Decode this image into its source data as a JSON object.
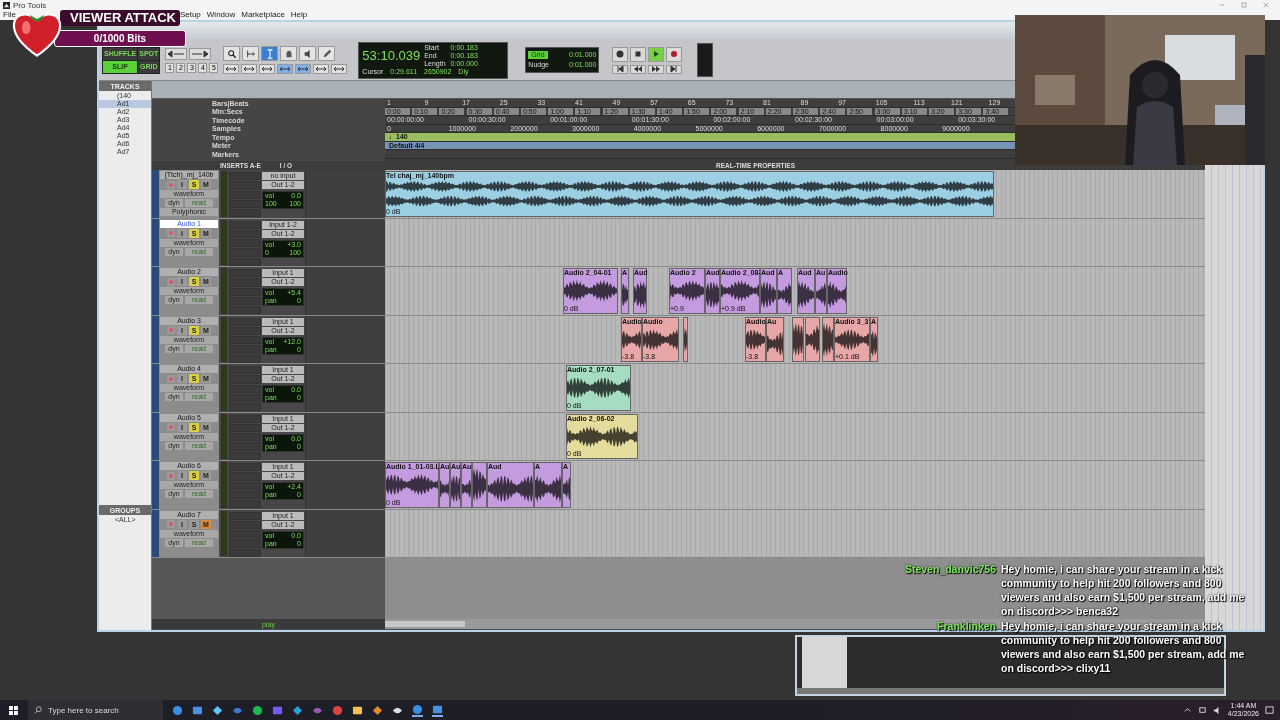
{
  "window": {
    "title": "Pro Tools"
  },
  "menu": [
    "File",
    "Setup",
    "Window",
    "Marketplace",
    "Help"
  ],
  "stream_alert": {
    "title": "VIEWER ATTACK",
    "progress_text": "0/1000 Bits",
    "level": 0
  },
  "toolbar": {
    "edit_modes": [
      {
        "label": "SHUFFLE",
        "selected": false
      },
      {
        "label": "SPOT",
        "selected": false
      },
      {
        "label": "SLIP",
        "selected": true
      },
      {
        "label": "GRID",
        "selected": false
      }
    ],
    "zoom_presets": [
      "1",
      "2",
      "3",
      "4",
      "5"
    ],
    "tools": [
      {
        "kind": "zoom",
        "selected": false
      },
      {
        "kind": "trim",
        "selected": false
      },
      {
        "kind": "selector",
        "selected": true
      },
      {
        "kind": "grabber",
        "selected": false
      },
      {
        "kind": "scrub",
        "selected": false
      },
      {
        "kind": "pencil",
        "selected": false
      }
    ],
    "main_counter": "53:10.039",
    "selection": [
      {
        "label": "Start",
        "value": "0:00.183"
      },
      {
        "label": "End",
        "value": "0:00.183"
      },
      {
        "label": "Length",
        "value": "0:00.000"
      }
    ],
    "cursor": {
      "label": "Cursor",
      "value": "0:29.611"
    },
    "sample_readout": "2650902",
    "delay_label": "Dly",
    "grid": {
      "label": "Grid",
      "value": "0:01.000"
    },
    "nudge": {
      "label": "Nudge",
      "value": "0:01.000"
    },
    "playing": true
  },
  "tracks_list": {
    "title": "TRACKS",
    "items": [
      {
        "name": "(140",
        "selected": false
      },
      {
        "name": "Ad1",
        "selected": true
      },
      {
        "name": "Ad2",
        "selected": false
      },
      {
        "name": "Ad3",
        "selected": false
      },
      {
        "name": "Ad4",
        "selected": false
      },
      {
        "name": "Ad5",
        "selected": false
      },
      {
        "name": "Ad6",
        "selected": false
      },
      {
        "name": "Ad7",
        "selected": false
      }
    ]
  },
  "groups_list": {
    "title": "GROUPS",
    "items": [
      "<ALL>"
    ]
  },
  "rulers": {
    "labels": [
      "Bars|Beats",
      "Min:Secs",
      "Timecode",
      "Samples",
      "Tempo",
      "Meter",
      "Markers"
    ],
    "bars": [
      "1",
      "9",
      "17",
      "25",
      "33",
      "41",
      "49",
      "57",
      "65",
      "73",
      "81",
      "89",
      "97",
      "105",
      "113",
      "121",
      "129"
    ],
    "min_secs": [
      "0:00",
      "0:10",
      "0:20",
      "0:30",
      "0:40",
      "0:50",
      "1:00",
      "1:10",
      "1:20",
      "1:30",
      "1:40",
      "1:50",
      "2:00",
      "2:10",
      "2:20",
      "2:30",
      "2:40",
      "2:50",
      "3:00",
      "3:10",
      "3:20",
      "3:30",
      "3:40"
    ],
    "timecode": [
      "00:00:00:00",
      "00:00:30:00",
      "00:01:00:00",
      "00:01:30:00",
      "00:02:00:00",
      "00:02:30:00",
      "00:03:00:00",
      "00:03:30:00"
    ],
    "samples": [
      "0",
      "1000000",
      "2000000",
      "3000000",
      "4000000",
      "5000000",
      "6000000",
      "7000000",
      "8000000",
      "9000000"
    ],
    "tempo": "♩140",
    "meter": "Default 4/4"
  },
  "columns": [
    "INSERTS A-E",
    "I / O",
    "REAL-TIME PROPERTIES"
  ],
  "tracks": [
    {
      "name": "(Ttch)_mj_140b",
      "selected": false,
      "monitor_label": "I",
      "solo_label": "S",
      "mute_label": "M",
      "solo": true,
      "mute": false,
      "view": "waveform",
      "dyn": "dyn",
      "automation": "read",
      "extra": "Polyphonic",
      "input": "no input",
      "output": "Out 1-2",
      "mix": {
        "vol_label": "vol",
        "vol": "0.0",
        "pan": [
          "100",
          "100"
        ]
      },
      "color": "#9ccfe3",
      "clips": [
        {
          "name": "Tel chaj_mj_140bpm",
          "gain": "0 dB",
          "selected": false
        }
      ]
    },
    {
      "name": "Audio 1",
      "selected": true,
      "monitor_label": "I",
      "solo_label": "S",
      "mute_label": "M",
      "solo": true,
      "mute": false,
      "view": "waveform",
      "dyn": "dyn",
      "automation": "read",
      "input": "Input 1-2",
      "output": "Out 1-2",
      "mix": {
        "vol_label": "vol",
        "vol": "+3.0",
        "pan": [
          "0",
          "100"
        ]
      }
    },
    {
      "name": "Audio 2",
      "selected": false,
      "monitor_label": "I",
      "solo_label": "S",
      "mute_label": "M",
      "solo": true,
      "mute": false,
      "view": "waveform",
      "dyn": "dyn",
      "automation": "read",
      "input": "Input 1",
      "output": "Out 1-2",
      "mix": {
        "vol_label": "vol",
        "vol": "+5.4",
        "pan_label": "pan",
        "pan": [
          "0"
        ]
      },
      "color": "#c59be0",
      "clips": [
        {
          "name": "Audio 2_04-01",
          "gain": "0 dB",
          "selected": false
        },
        {
          "name": "A",
          "selected": false
        },
        {
          "name": "Aud",
          "selected": false
        },
        {
          "name": "Audio 2",
          "gain": "+0.9",
          "selected": false
        },
        {
          "name": "Aud",
          "selected": false
        },
        {
          "name": "Audio 2_08-",
          "gain": "+0.9 dB",
          "selected": false
        },
        {
          "name": "Aud",
          "selected": false
        },
        {
          "name": "A",
          "selected": false
        },
        {
          "name": "Aud",
          "selected": false
        },
        {
          "name": "Au",
          "selected": false
        },
        {
          "name": "Audio",
          "selected": false
        }
      ]
    },
    {
      "name": "Audio 3",
      "selected": false,
      "monitor_label": "I",
      "solo_label": "S",
      "mute_label": "M",
      "solo": true,
      "mute": false,
      "view": "waveform",
      "dyn": "dyn",
      "automation": "read",
      "input": "Input 1",
      "output": "Out 1-2",
      "mix": {
        "vol_label": "vol",
        "vol": "+12.0",
        "pan_label": "pan",
        "pan": [
          "0"
        ]
      },
      "color": "#e7a7a7",
      "clips": [
        {
          "name": "Audio",
          "gain": "-3.8",
          "selected": false
        },
        {
          "name": "Audio",
          "gain": "-3.8",
          "selected": false
        },
        {
          "selected": false
        },
        {
          "name": "Audio",
          "gain": "-3.8",
          "selected": false
        },
        {
          "name": "Au",
          "selected": false
        },
        {
          "selected": false
        },
        {
          "selected": false
        },
        {
          "selected": false
        },
        {
          "name": "Audio 3_3",
          "gain": "+0.1 dB",
          "selected": false
        },
        {
          "name": "A",
          "selected": false
        }
      ]
    },
    {
      "name": "Audio 4",
      "selected": false,
      "monitor_label": "I",
      "solo_label": "S",
      "mute_label": "M",
      "solo": true,
      "mute": false,
      "view": "waveform",
      "dyn": "dyn",
      "automation": "read",
      "input": "Input 1",
      "output": "Out 1-2",
      "mix": {
        "vol_label": "vol",
        "vol": "0.0",
        "pan_label": "pan",
        "pan": [
          "0"
        ]
      },
      "color": "#a6dcc0",
      "clips": [
        {
          "name": "Audio 2_07-01",
          "gain": "0 dB",
          "selected": false
        }
      ]
    },
    {
      "name": "Audio 5",
      "selected": false,
      "monitor_label": "I",
      "solo_label": "S",
      "mute_label": "M",
      "solo": true,
      "mute": false,
      "view": "waveform",
      "dyn": "dyn",
      "automation": "read",
      "input": "Input 1",
      "output": "Out 1-2",
      "mix": {
        "vol_label": "vol",
        "vol": "0.0",
        "pan_label": "pan",
        "pan": [
          "0"
        ]
      },
      "color": "#e3dc9c",
      "clips": [
        {
          "name": "Audio 2_06-02",
          "gain": "0 dB",
          "selected": false
        }
      ]
    },
    {
      "name": "Audio 6",
      "selected": false,
      "monitor_label": "I",
      "solo_label": "S",
      "mute_label": "M",
      "solo": true,
      "mute": false,
      "view": "waveform",
      "dyn": "dyn",
      "automation": "read",
      "input": "Input 1",
      "output": "Out 1-2",
      "mix": {
        "vol_label": "vol",
        "vol": "+2.4",
        "pan_label": "pan",
        "pan": [
          "0"
        ]
      },
      "color": "#c59be0",
      "clips": [
        {
          "name": "Audio 1_01-03.L",
          "gain": "0 dB",
          "selected": false
        },
        {
          "name": "Au",
          "selected": false
        },
        {
          "name": "Au",
          "selected": false
        },
        {
          "name": "Au",
          "selected": false
        },
        {
          "selected": false
        },
        {
          "name": "Aud",
          "selected": false
        },
        {
          "name": "A",
          "selected": false
        },
        {
          "name": "A",
          "selected": false
        }
      ]
    },
    {
      "name": "Audio 7",
      "selected": false,
      "monitor_label": "I",
      "solo_label": "S",
      "mute_label": "M",
      "solo": false,
      "mute": true,
      "view": "waveform",
      "dyn": "dyn",
      "automation": "read",
      "input": "Input 1",
      "output": "Out 1-2",
      "mix": {
        "vol_label": "vol",
        "vol": "0.0",
        "pan_label": "pan",
        "pan": [
          "0"
        ]
      }
    }
  ],
  "status_text": "play",
  "chat": [
    {
      "user": "Steven_danvic756",
      "message": "Hey homie, i can share your stream in a kick community to help hit 200 followers and 800 viewers and also earn $1,500 per stream, add me on discord>>> benca32"
    },
    {
      "user": "Franklinken",
      "message": "Hey homie, i can share your stream in a kick community to help hit 200 followers and 800 viewers and also earn $1,500 per stream, add me on discord>>> clixy11"
    }
  ],
  "taskbar": {
    "search_placeholder": "Type here to search",
    "time": "1:44 AM",
    "date": "4/23/2026"
  }
}
